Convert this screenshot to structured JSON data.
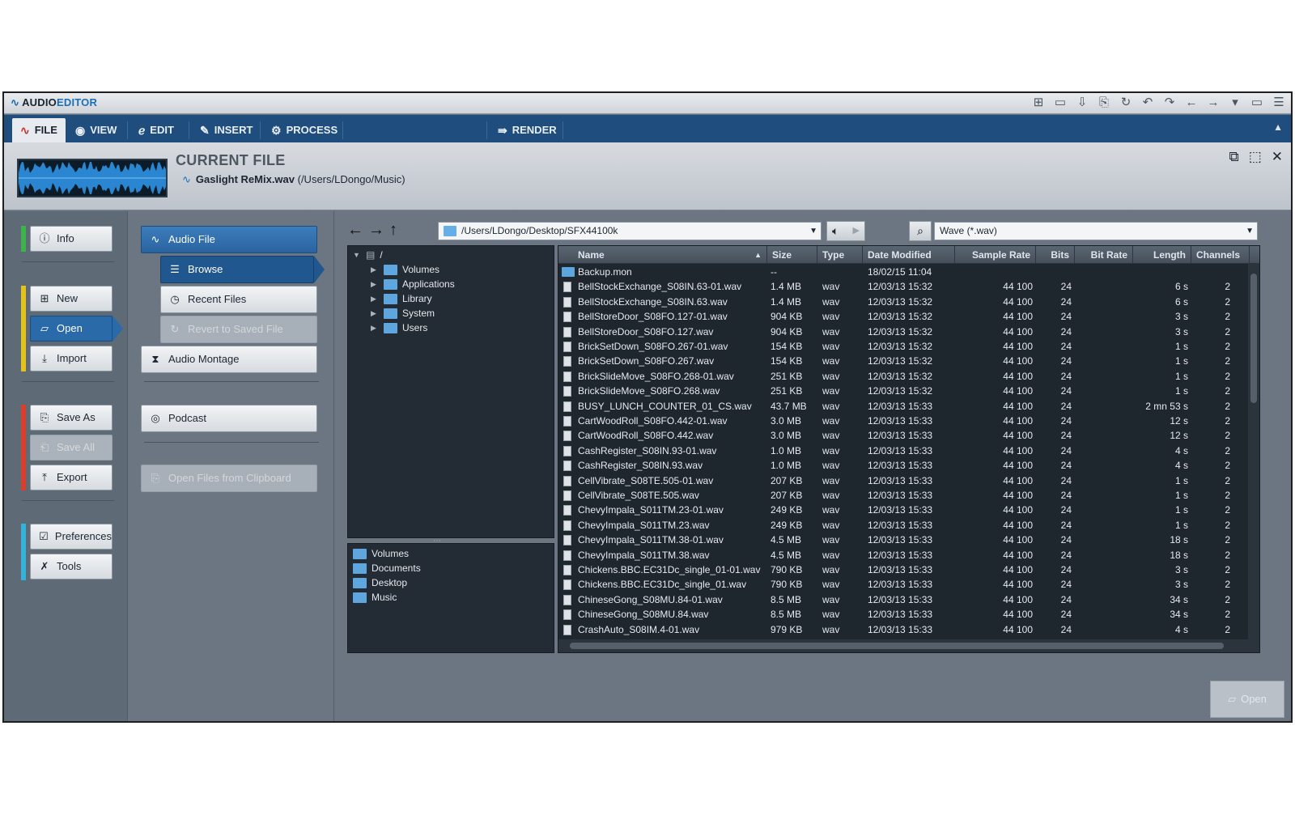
{
  "app": {
    "name_a": "AUDIO",
    "name_b": "EDITOR"
  },
  "tabs": [
    {
      "label": "FILE",
      "icon": "wave-icon"
    },
    {
      "label": "VIEW",
      "icon": "eye-icon"
    },
    {
      "label": "EDIT",
      "icon": "edit-icon"
    },
    {
      "label": "INSERT",
      "icon": "insert-icon"
    },
    {
      "label": "PROCESS",
      "icon": "gears-icon"
    },
    {
      "label": "RENDER",
      "icon": "render-icon"
    }
  ],
  "current_file": {
    "title": "CURRENT FILE",
    "name": "Gaslight ReMix.wav",
    "path": " (/Users/LDongo/Music)"
  },
  "left_nav": {
    "info": "Info",
    "new": "New",
    "open": "Open",
    "import": "Import",
    "save_as": "Save As",
    "save_all": "Save All",
    "export": "Export",
    "preferences": "Preferences",
    "tools": "Tools"
  },
  "actions": {
    "audio_file": "Audio File",
    "browse": "Browse",
    "recent_files": "Recent Files",
    "revert": "Revert to Saved File",
    "audio_montage": "Audio Montage",
    "podcast": "Podcast",
    "open_clipboard": "Open Files from Clipboard"
  },
  "browser": {
    "path": "/Users/LDongo/Desktop/SFX44100k",
    "filter": "Wave (*.wav)",
    "root": "/",
    "tree": [
      "Volumes",
      "Applications",
      "Library",
      "System",
      "Users"
    ],
    "favorites": [
      "Volumes",
      "Documents",
      "Desktop",
      "Music"
    ],
    "open_button": "Open"
  },
  "columns": [
    "Name",
    "Size",
    "Type",
    "Date Modified",
    "Sample Rate",
    "Bits",
    "Bit Rate",
    "Length",
    "Channels"
  ],
  "files": [
    {
      "name": "Backup.mon",
      "size": "--",
      "type": "",
      "date": "18/02/15 11:04",
      "rate": "",
      "bits": "",
      "length": "",
      "ch": "",
      "folder": true
    },
    {
      "name": "BellStockExchange_S08IN.63-01.wav",
      "size": "1.4 MB",
      "type": "wav",
      "date": "12/03/13 15:32",
      "rate": "44 100",
      "bits": "24",
      "length": "6 s",
      "ch": "2"
    },
    {
      "name": "BellStockExchange_S08IN.63.wav",
      "size": "1.4 MB",
      "type": "wav",
      "date": "12/03/13 15:32",
      "rate": "44 100",
      "bits": "24",
      "length": "6 s",
      "ch": "2"
    },
    {
      "name": "BellStoreDoor_S08FO.127-01.wav",
      "size": "904 KB",
      "type": "wav",
      "date": "12/03/13 15:32",
      "rate": "44 100",
      "bits": "24",
      "length": "3 s",
      "ch": "2"
    },
    {
      "name": "BellStoreDoor_S08FO.127.wav",
      "size": "904 KB",
      "type": "wav",
      "date": "12/03/13 15:32",
      "rate": "44 100",
      "bits": "24",
      "length": "3 s",
      "ch": "2"
    },
    {
      "name": "BrickSetDown_S08FO.267-01.wav",
      "size": "154 KB",
      "type": "wav",
      "date": "12/03/13 15:32",
      "rate": "44 100",
      "bits": "24",
      "length": "1 s",
      "ch": "2"
    },
    {
      "name": "BrickSetDown_S08FO.267.wav",
      "size": "154 KB",
      "type": "wav",
      "date": "12/03/13 15:32",
      "rate": "44 100",
      "bits": "24",
      "length": "1 s",
      "ch": "2"
    },
    {
      "name": "BrickSlideMove_S08FO.268-01.wav",
      "size": "251 KB",
      "type": "wav",
      "date": "12/03/13 15:32",
      "rate": "44 100",
      "bits": "24",
      "length": "1 s",
      "ch": "2"
    },
    {
      "name": "BrickSlideMove_S08FO.268.wav",
      "size": "251 KB",
      "type": "wav",
      "date": "12/03/13 15:32",
      "rate": "44 100",
      "bits": "24",
      "length": "1 s",
      "ch": "2"
    },
    {
      "name": "BUSY_LUNCH_COUNTER_01_CS.wav",
      "size": "43.7 MB",
      "type": "wav",
      "date": "12/03/13 15:33",
      "rate": "44 100",
      "bits": "24",
      "length": "2 mn 53 s",
      "ch": "2"
    },
    {
      "name": "CartWoodRoll_S08FO.442-01.wav",
      "size": "3.0 MB",
      "type": "wav",
      "date": "12/03/13 15:33",
      "rate": "44 100",
      "bits": "24",
      "length": "12 s",
      "ch": "2"
    },
    {
      "name": "CartWoodRoll_S08FO.442.wav",
      "size": "3.0 MB",
      "type": "wav",
      "date": "12/03/13 15:33",
      "rate": "44 100",
      "bits": "24",
      "length": "12 s",
      "ch": "2"
    },
    {
      "name": "CashRegister_S08IN.93-01.wav",
      "size": "1.0 MB",
      "type": "wav",
      "date": "12/03/13 15:33",
      "rate": "44 100",
      "bits": "24",
      "length": "4 s",
      "ch": "2"
    },
    {
      "name": "CashRegister_S08IN.93.wav",
      "size": "1.0 MB",
      "type": "wav",
      "date": "12/03/13 15:33",
      "rate": "44 100",
      "bits": "24",
      "length": "4 s",
      "ch": "2"
    },
    {
      "name": "CellVibrate_S08TE.505-01.wav",
      "size": "207 KB",
      "type": "wav",
      "date": "12/03/13 15:33",
      "rate": "44 100",
      "bits": "24",
      "length": "1 s",
      "ch": "2"
    },
    {
      "name": "CellVibrate_S08TE.505.wav",
      "size": "207 KB",
      "type": "wav",
      "date": "12/03/13 15:33",
      "rate": "44 100",
      "bits": "24",
      "length": "1 s",
      "ch": "2"
    },
    {
      "name": "ChevyImpala_S011TM.23-01.wav",
      "size": "249 KB",
      "type": "wav",
      "date": "12/03/13 15:33",
      "rate": "44 100",
      "bits": "24",
      "length": "1 s",
      "ch": "2"
    },
    {
      "name": "ChevyImpala_S011TM.23.wav",
      "size": "249 KB",
      "type": "wav",
      "date": "12/03/13 15:33",
      "rate": "44 100",
      "bits": "24",
      "length": "1 s",
      "ch": "2"
    },
    {
      "name": "ChevyImpala_S011TM.38-01.wav",
      "size": "4.5 MB",
      "type": "wav",
      "date": "12/03/13 15:33",
      "rate": "44 100",
      "bits": "24",
      "length": "18 s",
      "ch": "2"
    },
    {
      "name": "ChevyImpala_S011TM.38.wav",
      "size": "4.5 MB",
      "type": "wav",
      "date": "12/03/13 15:33",
      "rate": "44 100",
      "bits": "24",
      "length": "18 s",
      "ch": "2"
    },
    {
      "name": "Chickens.BBC.EC31Dc_single_01-01.wav",
      "size": "790 KB",
      "type": "wav",
      "date": "12/03/13 15:33",
      "rate": "44 100",
      "bits": "24",
      "length": "3 s",
      "ch": "2"
    },
    {
      "name": "Chickens.BBC.EC31Dc_single_01.wav",
      "size": "790 KB",
      "type": "wav",
      "date": "12/03/13 15:33",
      "rate": "44 100",
      "bits": "24",
      "length": "3 s",
      "ch": "2"
    },
    {
      "name": "ChineseGong_S08MU.84-01.wav",
      "size": "8.5 MB",
      "type": "wav",
      "date": "12/03/13 15:33",
      "rate": "44 100",
      "bits": "24",
      "length": "34 s",
      "ch": "2"
    },
    {
      "name": "ChineseGong_S08MU.84.wav",
      "size": "8.5 MB",
      "type": "wav",
      "date": "12/03/13 15:33",
      "rate": "44 100",
      "bits": "24",
      "length": "34 s",
      "ch": "2"
    },
    {
      "name": "CrashAuto_S08IM.4-01.wav",
      "size": "979 KB",
      "type": "wav",
      "date": "12/03/13 15:33",
      "rate": "44 100",
      "bits": "24",
      "length": "4 s",
      "ch": "2"
    }
  ],
  "colors": {
    "accent": "#2a6aa8",
    "tabbar": "#1f4e7e",
    "info_bar": "#3cb44a",
    "file_bar": "#e2c21b",
    "save_bar": "#d9402c",
    "pref_bar": "#33b3d9"
  }
}
